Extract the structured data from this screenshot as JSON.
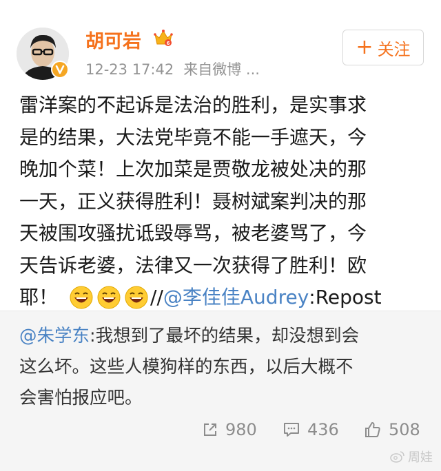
{
  "post": {
    "author": "胡可岩",
    "time": "12-23 17:42",
    "source": "来自微博 ...",
    "follow_label": "关注",
    "follow_plus": "+",
    "lines": [
      "雷洋案的不起诉是法治的胜利，是实事求",
      "是的结果，大法党毕竟不能一手遮天，今",
      "晚加个菜！上次加菜是贾敬龙被处决的那",
      "一天，正义获得胜利！聂树斌案判决的那",
      "天被围攻骚扰诋毁辱骂，被老婆骂了，今",
      "天告诉老婆，法律又一次获得了胜利！欧"
    ],
    "last_line_prefix": "耶！",
    "separator": "//",
    "mention": "@李佳佳Audrey",
    "repost_suffix": ":Repost"
  },
  "repost": {
    "mention": "@朱学东",
    "first_line_text": ":我想到了最坏的结果，却没想到会",
    "line2": "这么坏。这些人模狗样的东西，以后大概不",
    "line3": "会害怕报应吧。"
  },
  "actions": {
    "reposts": "980",
    "comments": "436",
    "likes": "508"
  },
  "watermark": "周娃",
  "icons": [
    "verified-badge-icon",
    "crown-vip-icon",
    "laugh-emoji-icon",
    "share-icon",
    "comment-icon",
    "like-icon",
    "weibo-logo-icon"
  ],
  "colors": {
    "username": "#f5721d",
    "mention": "#4a83c4",
    "meta": "#939393",
    "repost_bg": "#f5f5f5",
    "verified": "#f5a623"
  }
}
